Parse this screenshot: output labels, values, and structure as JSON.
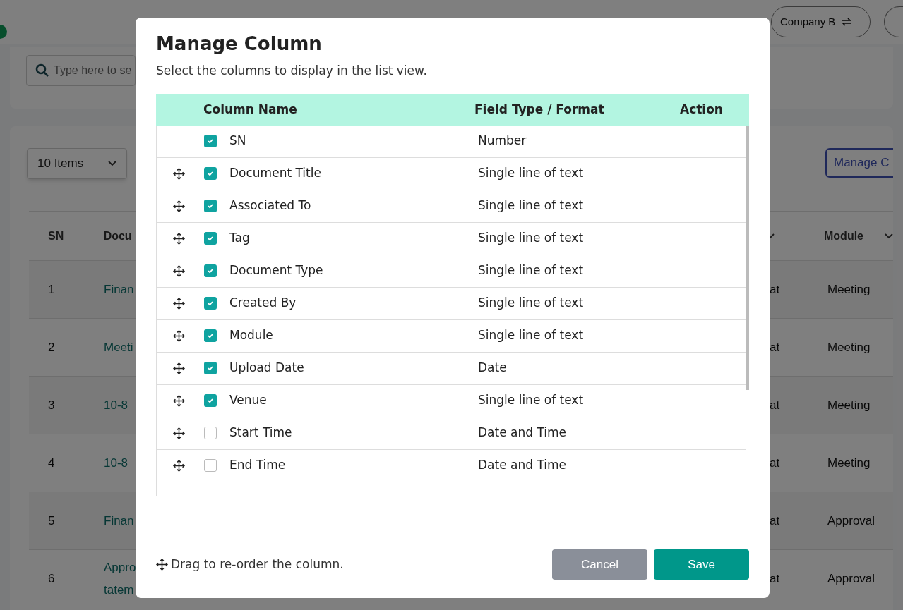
{
  "background": {
    "company_switch": "Company B",
    "search": {
      "placeholder": "Type here to se"
    },
    "page_size": "10 Items",
    "manage_button": "Manage C",
    "table": {
      "columns": [
        "SN",
        "Docu",
        "",
        "Module"
      ],
      "rows": [
        {
          "sn": "1",
          "document": [
            "Finan"
          ],
          "column_3": "at",
          "module": "Meeting"
        },
        {
          "sn": "2",
          "document": [
            "Meeti"
          ],
          "column_3": "at",
          "module": "Meeting"
        },
        {
          "sn": "3",
          "document": [
            "10-8"
          ],
          "column_3": "at",
          "module": "Meeting"
        },
        {
          "sn": "4",
          "document": [
            "10-8"
          ],
          "column_3": "at",
          "module": "Meeting"
        },
        {
          "sn": "5",
          "document": [
            "Finan"
          ],
          "column_3": "at",
          "module": "Approval"
        },
        {
          "sn": "6",
          "document": [
            "Appro",
            "tatem"
          ],
          "column_3": "at",
          "module": "Approval"
        }
      ]
    }
  },
  "dialog": {
    "title": "Manage Column",
    "subtitle": "Select the columns to display in the list view.",
    "table": {
      "columns": [
        "Column Name",
        "Field Type / Format",
        "Action"
      ],
      "rows": [
        {
          "name": "SN",
          "type": "Number",
          "checked": true,
          "draggable": false
        },
        {
          "name": "Document Title",
          "type": "Single line of text",
          "checked": true,
          "draggable": true
        },
        {
          "name": "Associated To",
          "type": "Single line of text",
          "checked": true,
          "draggable": true
        },
        {
          "name": "Tag",
          "type": "Single line of text",
          "checked": true,
          "draggable": true
        },
        {
          "name": "Document Type",
          "type": "Single line of text",
          "checked": true,
          "draggable": true
        },
        {
          "name": "Created By",
          "type": "Single line of text",
          "checked": true,
          "draggable": true
        },
        {
          "name": "Module",
          "type": "Single line of text",
          "checked": true,
          "draggable": true
        },
        {
          "name": "Upload Date",
          "type": "Date",
          "checked": true,
          "draggable": true
        },
        {
          "name": "Venue",
          "type": "Single line of text",
          "checked": true,
          "draggable": true
        },
        {
          "name": "Start Time",
          "type": "Date and Time",
          "checked": false,
          "draggable": true
        },
        {
          "name": "End Time",
          "type": "Date and Time",
          "checked": false,
          "draggable": true
        }
      ]
    },
    "footer_note": "Drag to re-order the column.",
    "buttons": [
      {
        "label": "Cancel",
        "kind": "secondary"
      },
      {
        "label": "Save",
        "kind": "primary"
      }
    ]
  }
}
